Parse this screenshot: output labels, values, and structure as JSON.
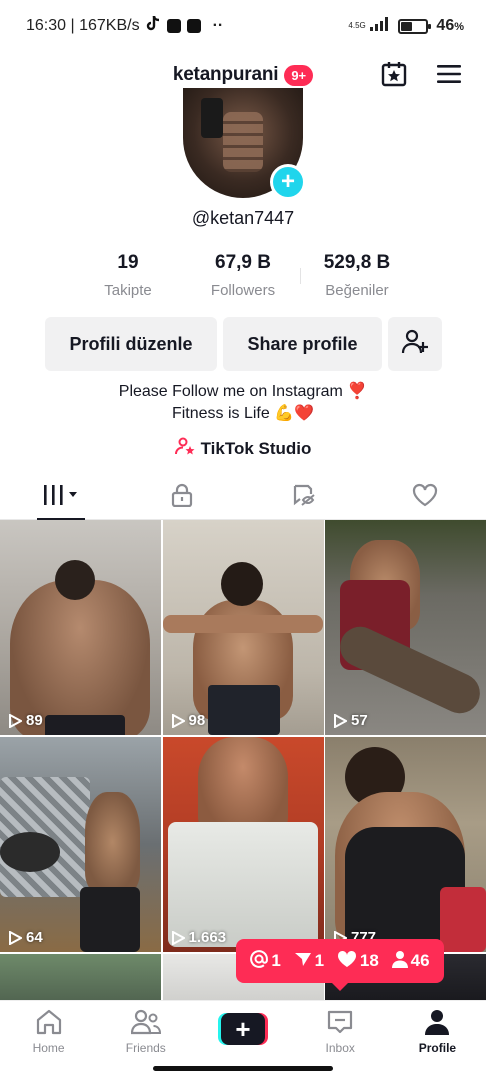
{
  "status_bar": {
    "time_speed": "16:30 | 167KB/s",
    "dots": "··",
    "network": "4.5G",
    "battery_text": "46",
    "battery_percent_sign": "%",
    "battery_level": 0.46
  },
  "header": {
    "username": "ketanpurani",
    "notification_badge": "9+"
  },
  "profile": {
    "handle": "@ketan7447",
    "add_icon": "+"
  },
  "stats": [
    {
      "value": "19",
      "label": "Takipte"
    },
    {
      "value": "67,9 B",
      "label": "Followers"
    },
    {
      "value": "529,8 B",
      "label": "Beğeniler"
    }
  ],
  "actions": {
    "edit": "Profili düzenle",
    "share": "Share profile"
  },
  "bio": {
    "line1": "Please Follow me on Instagram ❣️",
    "line2": "Fitness is Life 💪❤️"
  },
  "studio": {
    "label": "TikTok Studio"
  },
  "tabs": [
    "videos-grid-icon",
    "lock-icon",
    "repost-icon",
    "heart-icon"
  ],
  "videos": [
    {
      "views": "89"
    },
    {
      "views": "98"
    },
    {
      "views": "57"
    },
    {
      "views": "64"
    },
    {
      "views": "1.663"
    },
    {
      "views": "777"
    }
  ],
  "activity": {
    "mentions": "1",
    "shares": "1",
    "likes": "18",
    "followers": "46"
  },
  "nav": {
    "home": "Home",
    "friends": "Friends",
    "inbox": "Inbox",
    "profile": "Profile"
  },
  "colors": {
    "accent": "#fe2c55",
    "cyan": "#25f4ee",
    "add_button": "#20d5ec",
    "text": "#161823",
    "muted": "#8a8b91"
  }
}
